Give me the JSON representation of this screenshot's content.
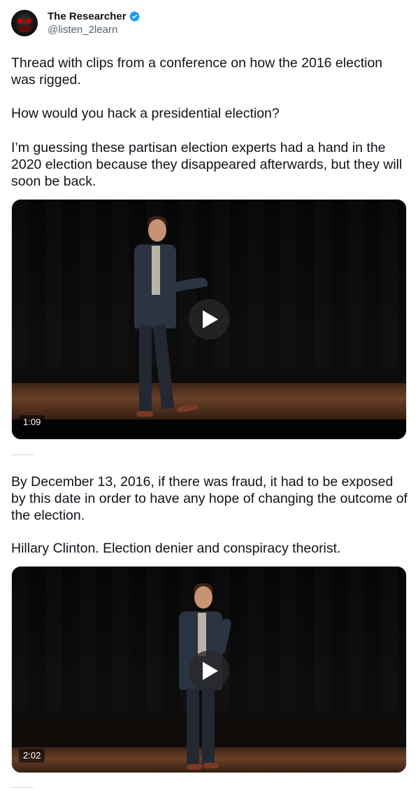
{
  "author": {
    "display_name": "The Researcher",
    "handle": "@listen_2learn",
    "verified_color": "#1d9bf0"
  },
  "tweet1": {
    "paragraphs": [
      "Thread with clips from a conference on how the 2016 election was rigged.",
      "How would you hack a presidential election?",
      "I’m guessing these partisan election experts had a hand in the 2020 election because they disappeared afterwards, but they will soon be back."
    ],
    "video": {
      "duration": "1:09",
      "icon": "play-icon"
    }
  },
  "tweet2": {
    "paragraphs": [
      "By December 13, 2016, if there was fraud, it had to be exposed by this date in order to have any hope of changing the outcome of the election.",
      "Hillary Clinton. Election denier and conspiracy theorist."
    ],
    "video": {
      "duration": "2:02",
      "icon": "play-icon"
    }
  }
}
